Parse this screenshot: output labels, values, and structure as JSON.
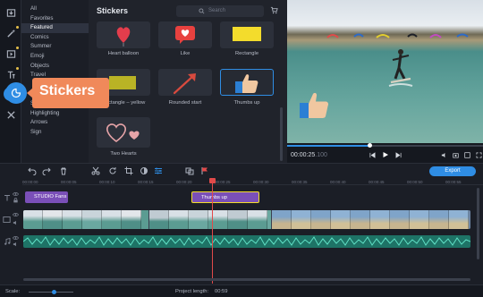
{
  "sidebar": {
    "tools": [
      {
        "icon": "import-icon"
      },
      {
        "icon": "magic-wand-icon"
      },
      {
        "icon": "transitions-icon"
      },
      {
        "icon": "titles-icon"
      },
      {
        "icon": "stickers-icon"
      },
      {
        "icon": "tools-icon"
      }
    ]
  },
  "categories": [
    "All",
    "Favorites",
    "Featured",
    "Comics",
    "Summer",
    "Emoji",
    "Objects",
    "Travel",
    "",
    "",
    "Shapes",
    "Highlighting",
    "Arrows",
    "Sign"
  ],
  "selected_category": "Featured",
  "gallery": {
    "title": "Stickers",
    "search_placeholder": "Search",
    "items": [
      {
        "label": "Heart balloon"
      },
      {
        "label": "Like"
      },
      {
        "label": "Rectangle"
      },
      {
        "label": "Rectangle – yellow"
      },
      {
        "label": "Rounded start"
      },
      {
        "label": "Thumbs up"
      },
      {
        "label": "Two Hearts"
      }
    ]
  },
  "callout": {
    "label": "Stickers"
  },
  "player": {
    "timecode": "00:00:25",
    "timecode_ms": ".100"
  },
  "toolbar": {
    "export_label": "Export"
  },
  "ruler_ticks": [
    "00:00:00",
    "00:00:05",
    "00:00:10",
    "00:00:15",
    "00:00:20",
    "00:00:25",
    "00:00:30",
    "00:00:35",
    "00:00:40",
    "00:00:45",
    "00:00:50",
    "00:00:55"
  ],
  "timeline": {
    "title_clip_1": "STUDIO Fans",
    "title_clip_2": "Thumbs up"
  },
  "status": {
    "scale_label": "Scale:",
    "project_length_label": "Project length:",
    "project_length_value": "00:59"
  },
  "colors": {
    "accent": "#2f8de4",
    "callout": "#f0895a",
    "title_clip": "#7a4fb8",
    "audio": "#1e7366",
    "playhead": "#e14a4a"
  }
}
